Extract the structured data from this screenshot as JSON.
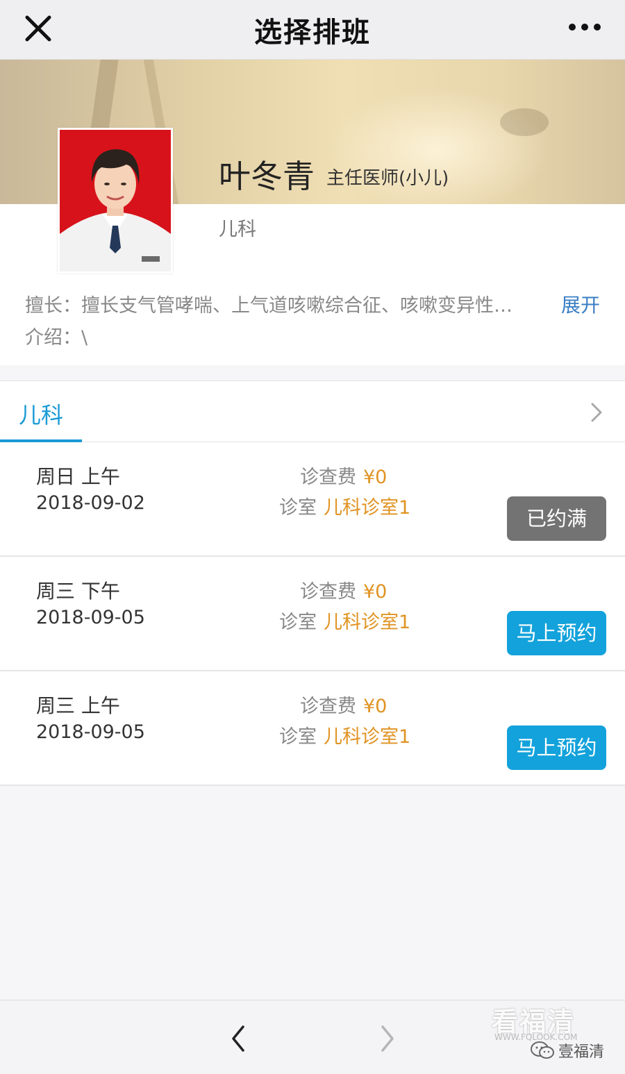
{
  "topbar": {
    "title": "选择排班",
    "close_icon": "close-icon",
    "more_icon": "more-dots-icon"
  },
  "doctor": {
    "name": "叶冬青",
    "title": "主任医师(小儿)",
    "department": "儿科",
    "specialty": "擅长：擅长支气管哮喘、上气道咳嗽综合征、咳嗽变异性…",
    "expand_label": "展开",
    "intro": "介绍：\\"
  },
  "tab": {
    "label": "儿科"
  },
  "schedule": [
    {
      "when": "周日 上午",
      "date": "2018-09-02",
      "fee_label": "诊查费",
      "fee_value": "¥0",
      "room_label": "诊室",
      "room_value": "儿科诊室1",
      "button_label": "已约满",
      "status": "full"
    },
    {
      "when": "周三 下午",
      "date": "2018-09-05",
      "fee_label": "诊查费",
      "fee_value": "¥0",
      "room_label": "诊室",
      "room_value": "儿科诊室1",
      "button_label": "马上预约",
      "status": "available"
    },
    {
      "when": "周三 上午",
      "date": "2018-09-05",
      "fee_label": "诊查费",
      "fee_value": "¥0",
      "room_label": "诊室",
      "room_value": "儿科诊室1",
      "button_label": "马上预约",
      "status": "available"
    }
  ],
  "watermark": {
    "brand": "看福清",
    "url": "WWW.FQLOOK.COM",
    "account": "壹福清"
  },
  "colors": {
    "accent_blue": "#1a9ad6",
    "book_button": "#13a2db",
    "full_button": "#737373",
    "price_orange": "#e09322",
    "link_blue": "#3a7fc4"
  }
}
